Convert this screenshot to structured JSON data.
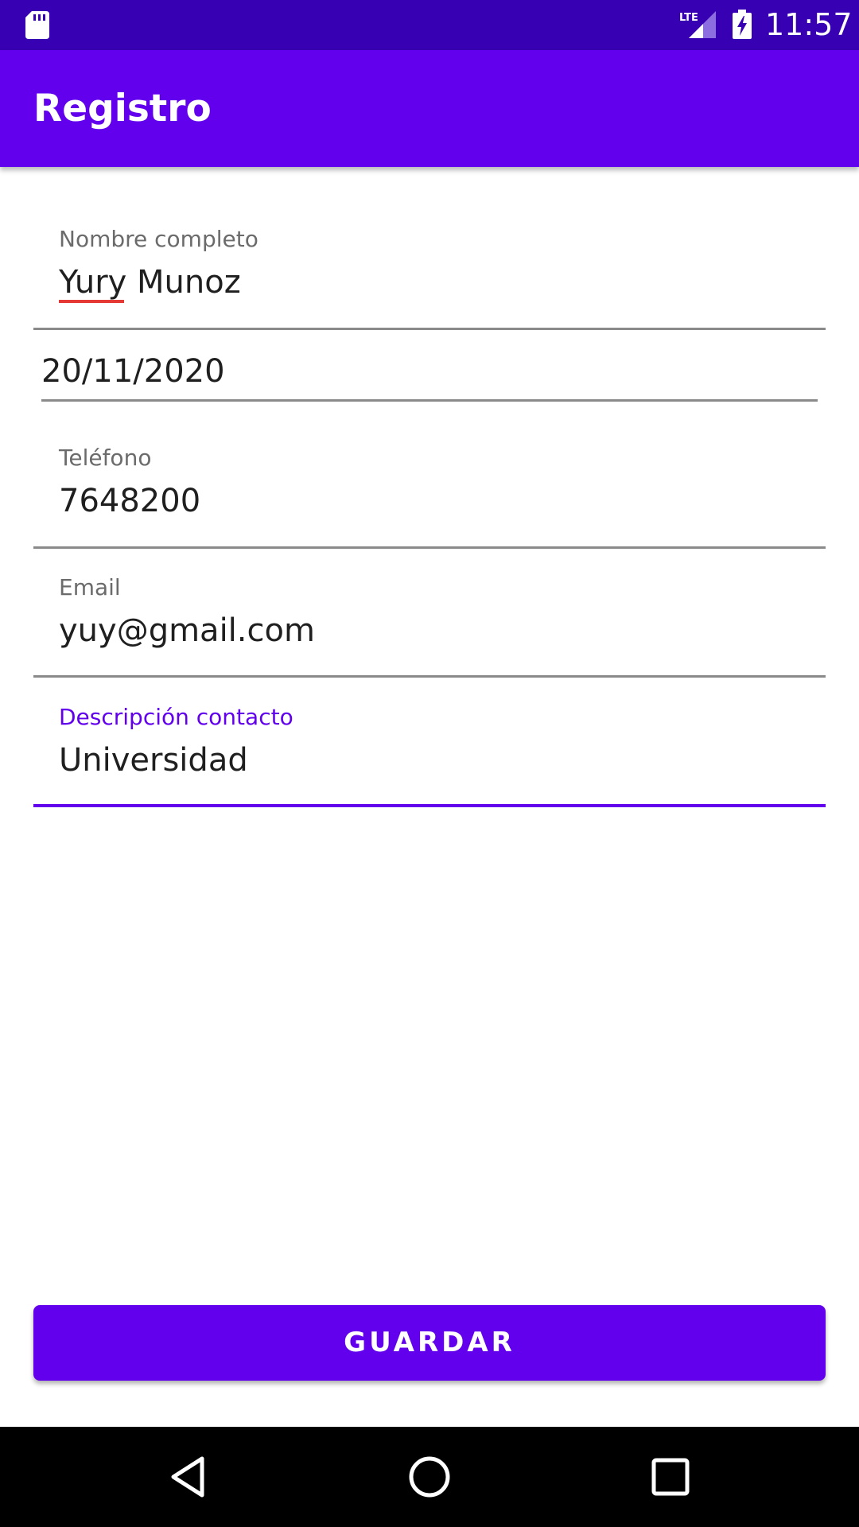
{
  "status_bar": {
    "time": "11:57",
    "icons": [
      "sd-card-icon",
      "lte-signal-icon",
      "battery-charging-icon"
    ],
    "network_label": "LTE"
  },
  "app_bar": {
    "title": "Registro"
  },
  "form": {
    "full_name": {
      "label": "Nombre completo",
      "value": "Yury Munoz"
    },
    "date": {
      "value": "20/11/2020"
    },
    "phone": {
      "label": "Teléfono",
      "value": "7648200"
    },
    "email": {
      "label": "Email",
      "value": "yuy@gmail.com"
    },
    "description": {
      "label": "Descripción contacto",
      "value": "Universidad"
    }
  },
  "save_button": {
    "label": "GUARDAR"
  },
  "nav_bar": {
    "icons": [
      "back-icon",
      "home-icon",
      "recents-icon"
    ]
  },
  "colors": {
    "primary": "#6200EE",
    "primary_dark": "#3700B3",
    "spell_error": "#e53935"
  }
}
